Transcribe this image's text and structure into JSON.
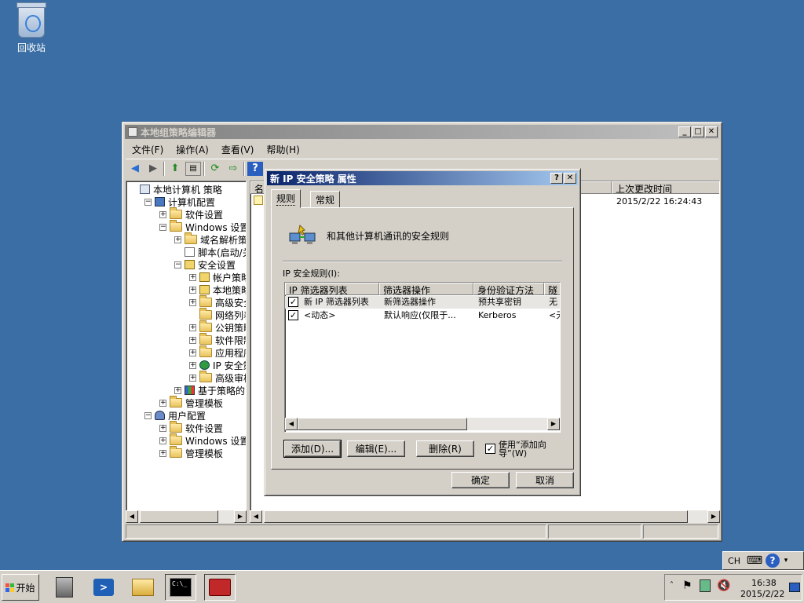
{
  "desktop": {
    "recycle_bin_label": "回收站"
  },
  "gpedit": {
    "title": "本地组策略编辑器",
    "menu": [
      "文件(F)",
      "操作(A)",
      "查看(V)",
      "帮助(H)"
    ],
    "tree": [
      {
        "label": "本地计算机 策略",
        "level": 0,
        "expander": "",
        "icon": "computer-policy-icon"
      },
      {
        "label": "计算机配置",
        "level": 1,
        "expander": "−",
        "icon": "computer-icon"
      },
      {
        "label": "软件设置",
        "level": 2,
        "expander": "+",
        "icon": "folder-icon"
      },
      {
        "label": "Windows 设置",
        "level": 2,
        "expander": "−",
        "icon": "folder-icon"
      },
      {
        "label": "域名解析策略",
        "level": 3,
        "expander": "+",
        "icon": "folder-icon"
      },
      {
        "label": "脚本(启动/关",
        "level": 3,
        "expander": "",
        "icon": "script-icon"
      },
      {
        "label": "安全设置",
        "level": 3,
        "expander": "−",
        "icon": "security-icon"
      },
      {
        "label": "帐户策略",
        "level": 4,
        "expander": "+",
        "icon": "security-icon"
      },
      {
        "label": "本地策略",
        "level": 4,
        "expander": "+",
        "icon": "security-icon"
      },
      {
        "label": "高级安全",
        "level": 4,
        "expander": "+",
        "icon": "folder-icon"
      },
      {
        "label": "网络列表管",
        "level": 4,
        "expander": "",
        "icon": "folder-icon"
      },
      {
        "label": "公钥策略",
        "level": 4,
        "expander": "+",
        "icon": "folder-icon"
      },
      {
        "label": "软件限制策",
        "level": 4,
        "expander": "+",
        "icon": "folder-icon"
      },
      {
        "label": "应用程序控",
        "level": 4,
        "expander": "+",
        "icon": "folder-icon"
      },
      {
        "label": "IP 安全策",
        "level": 4,
        "expander": "+",
        "icon": "ip-security-icon"
      },
      {
        "label": "高级审核策",
        "level": 4,
        "expander": "+",
        "icon": "folder-icon"
      },
      {
        "label": "基于策略的 Q",
        "level": 3,
        "expander": "+",
        "icon": "chart-icon"
      },
      {
        "label": "管理模板",
        "level": 2,
        "expander": "+",
        "icon": "folder-icon"
      },
      {
        "label": "用户配置",
        "level": 1,
        "expander": "−",
        "icon": "user-icon"
      },
      {
        "label": "软件设置",
        "level": 2,
        "expander": "+",
        "icon": "folder-icon"
      },
      {
        "label": "Windows 设置",
        "level": 2,
        "expander": "+",
        "icon": "folder-icon"
      },
      {
        "label": "管理模板",
        "level": 2,
        "expander": "+",
        "icon": "folder-icon"
      }
    ],
    "right_header": {
      "name_col": "名",
      "modified_col": "上次更改时间"
    },
    "right_row": {
      "modified": "2015/2/22 16:24:43"
    }
  },
  "dialog": {
    "title": "新 IP 安全策略 属性",
    "tabs": [
      "规则",
      "常规"
    ],
    "active_tab": "规则",
    "description": "和其他计算机通讯的安全规则",
    "rules_label": "IP 安全规则(I):",
    "columns": [
      "IP 筛选器列表",
      "筛选器操作",
      "身份验证方法",
      "隧"
    ],
    "rows": [
      {
        "checked": "✓",
        "filter": "新 IP 筛选器列表",
        "action": "新筛选器操作",
        "auth": "预共享密钥",
        "tunnel": "无"
      },
      {
        "checked": "✓",
        "filter": "<动态>",
        "action": "默认响应(仅限于...",
        "auth": "Kerberos",
        "tunnel": "<无"
      }
    ],
    "buttons": {
      "add": "添加(D)...",
      "edit": "编辑(E)...",
      "remove": "删除(R)"
    },
    "wizard_checkbox": {
      "checked": "✓",
      "label": "使用“添加向导”(W)"
    },
    "ok": "确定",
    "cancel": "取消"
  },
  "taskbar": {
    "start_label": "开始",
    "language": "CH",
    "time": "16:38",
    "date": "2015/2/22"
  }
}
